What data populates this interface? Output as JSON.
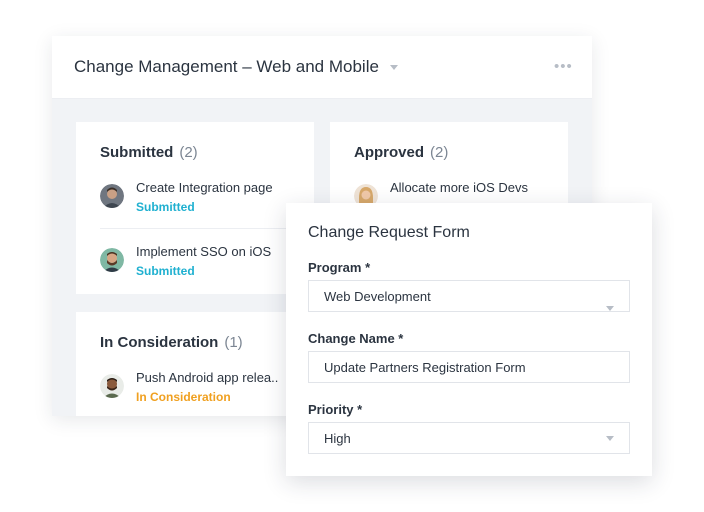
{
  "board": {
    "title": "Change Management – Web and Mobile",
    "more_label": "•••"
  },
  "columns": [
    {
      "title": "Submitted",
      "count": "(2)",
      "cards": [
        {
          "name": "Create Integration page",
          "status": "Submitted"
        },
        {
          "name": "Implement SSO on iOS",
          "status": "Submitted"
        }
      ]
    },
    {
      "title": "Approved",
      "count": "(2)",
      "cards": [
        {
          "name": "Allocate more iOS Devs"
        }
      ]
    },
    {
      "title": "In Consideration",
      "count": "(1)",
      "cards": [
        {
          "name": "Push Android app relea..",
          "status": "In Consideration"
        }
      ]
    }
  ],
  "form": {
    "title": "Change Request Form",
    "program": {
      "label": "Program *",
      "value": "Web Development"
    },
    "change_name": {
      "label": "Change Name *",
      "value": "Update Partners Registration Form"
    },
    "priority": {
      "label": "Priority *",
      "value": "High"
    }
  },
  "colors": {
    "status_submitted": "#1fb0d0",
    "status_consideration": "#f0a020",
    "text": "#2b3440",
    "muted": "#7c8693"
  }
}
